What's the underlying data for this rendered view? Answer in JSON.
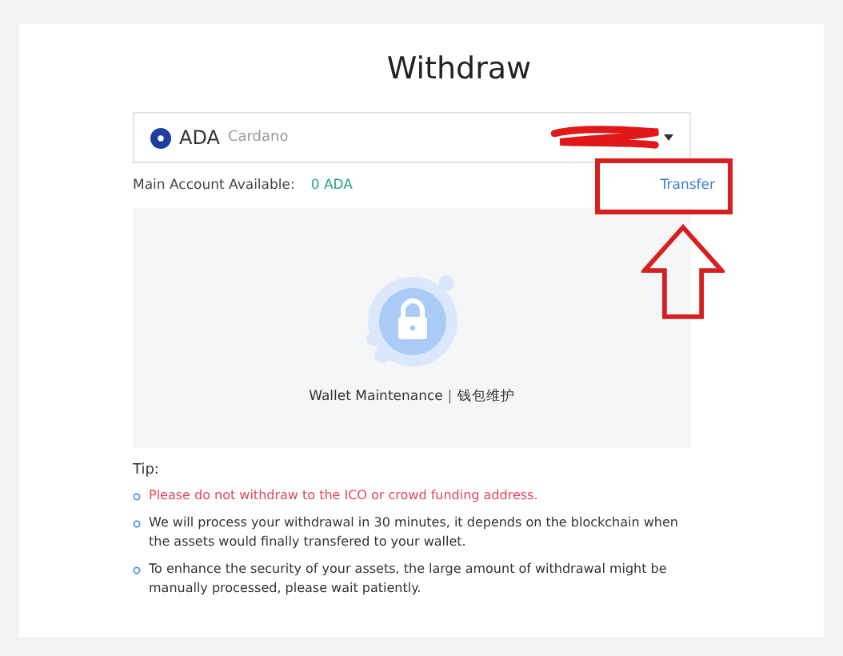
{
  "title": "Withdraw",
  "asset_select": {
    "symbol": "ADA",
    "name": "Cardano"
  },
  "available": {
    "label": "Main Account Available:",
    "value": "0 ADA"
  },
  "transfer_link": "Transfer",
  "maintenance": {
    "message": "Wallet Maintenance｜钱包维护"
  },
  "tips": {
    "heading": "Tip:",
    "items": [
      {
        "kind": "warning",
        "text": "Please do not withdraw to the ICO or crowd funding address."
      },
      {
        "kind": "normal",
        "text": "We will process your withdrawal in 30 minutes, it depends on the blockchain when the assets would finally transfered to your wallet."
      },
      {
        "kind": "normal",
        "text": "To enhance the security of your assets, the large amount of withdrawal might be manually processed, please wait patiently."
      }
    ]
  }
}
